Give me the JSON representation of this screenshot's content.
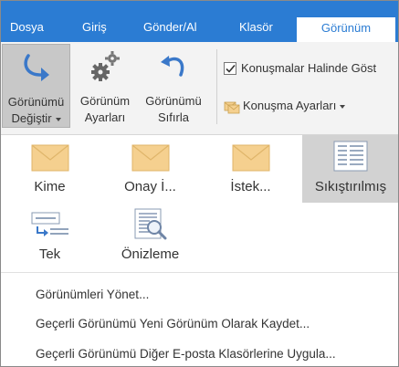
{
  "tabs": [
    "Dosya",
    "Giriş",
    "Gönder/Al",
    "Klasör",
    "Görünüm"
  ],
  "ribbon": {
    "change_view": {
      "line1": "Görünümü",
      "line2": "Değiştir"
    },
    "view_settings": {
      "line1": "Görünüm",
      "line2": "Ayarları"
    },
    "reset_view": {
      "line1": "Görünümü",
      "line2": "Sıfırla"
    },
    "show_as_conversations": {
      "label": "Konuşmalar Halinde Göst",
      "checked": true
    },
    "conversation_settings": {
      "label": "Konuşma Ayarları"
    }
  },
  "gallery": {
    "items": [
      {
        "label": "Kime",
        "icon": "envelope-icon"
      },
      {
        "label": "Onay İ...",
        "icon": "envelope-icon"
      },
      {
        "label": "İstek...",
        "icon": "envelope-icon"
      },
      {
        "label": "Sıkıştırılmış",
        "icon": "compact-list-icon",
        "selected": true
      },
      {
        "label": "Tek",
        "icon": "single-list-icon"
      },
      {
        "label": "Önizleme",
        "icon": "preview-icon"
      }
    ]
  },
  "menu": {
    "manage_views": "Görünümleri Yönet...",
    "save_as_new": "Geçerli Görünümü Yeni Görünüm Olarak Kaydet...",
    "apply_to_other": "Geçerli Görünümü Diğer E-posta Klasörlerine Uygula..."
  },
  "colors": {
    "accent": "#2b7cd3",
    "envelope": "#f5d08f",
    "selected_bg": "#d2d2d2"
  }
}
